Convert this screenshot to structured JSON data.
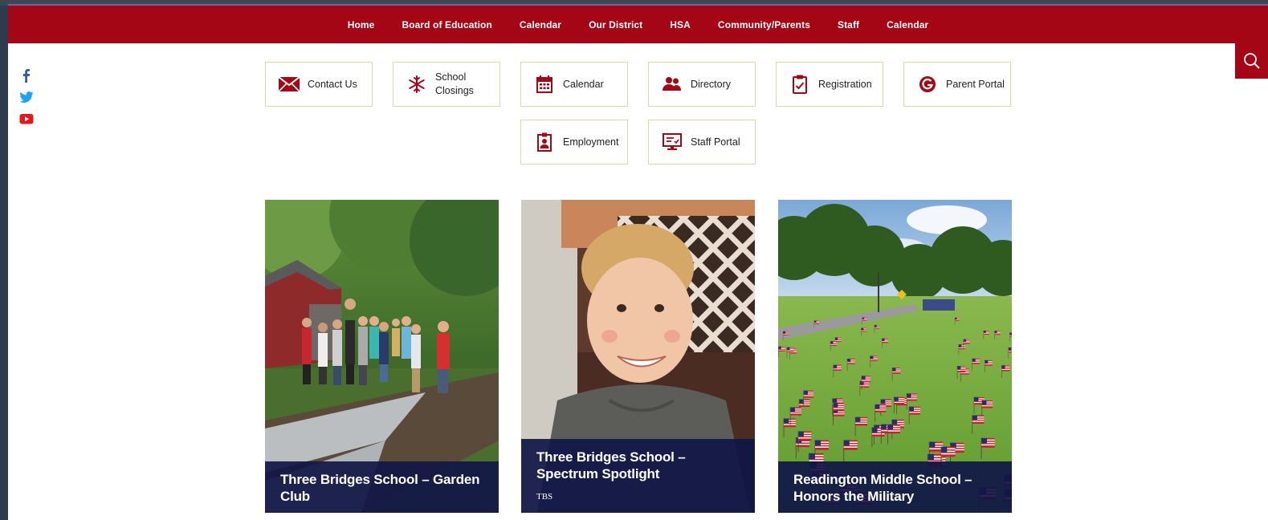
{
  "nav": {
    "items": [
      "Home",
      "Board of Education",
      "Calendar",
      "Our District",
      "HSA",
      "Community/Parents",
      "Staff",
      "Calendar"
    ]
  },
  "social": [
    "facebook-icon",
    "twitter-icon",
    "youtube-icon"
  ],
  "quick_links": [
    {
      "label": "Contact Us",
      "icon": "envelope-icon"
    },
    {
      "label": "School Closings",
      "icon": "snowflake-icon"
    },
    {
      "label": "Calendar",
      "icon": "calendar-icon"
    },
    {
      "label": "Directory",
      "icon": "people-icon"
    },
    {
      "label": "Registration",
      "icon": "clipboard-check-icon"
    },
    {
      "label": "Parent Portal",
      "icon": "portal-g-icon"
    },
    {
      "label": "Employment",
      "icon": "id-badge-icon"
    },
    {
      "label": "Staff Portal",
      "icon": "monitor-icon"
    }
  ],
  "news": [
    {
      "title": "Three Bridges School – Garden Club",
      "tag": ""
    },
    {
      "title": "Three Bridges School – Spectrum Spotlight",
      "tag": "TBS"
    },
    {
      "title": "Readington Middle School – Honors the Military",
      "tag": ""
    }
  ],
  "colors": {
    "brand": "#a50616",
    "caption_bg": "#101646",
    "quick_border": "#d9d8b0"
  }
}
